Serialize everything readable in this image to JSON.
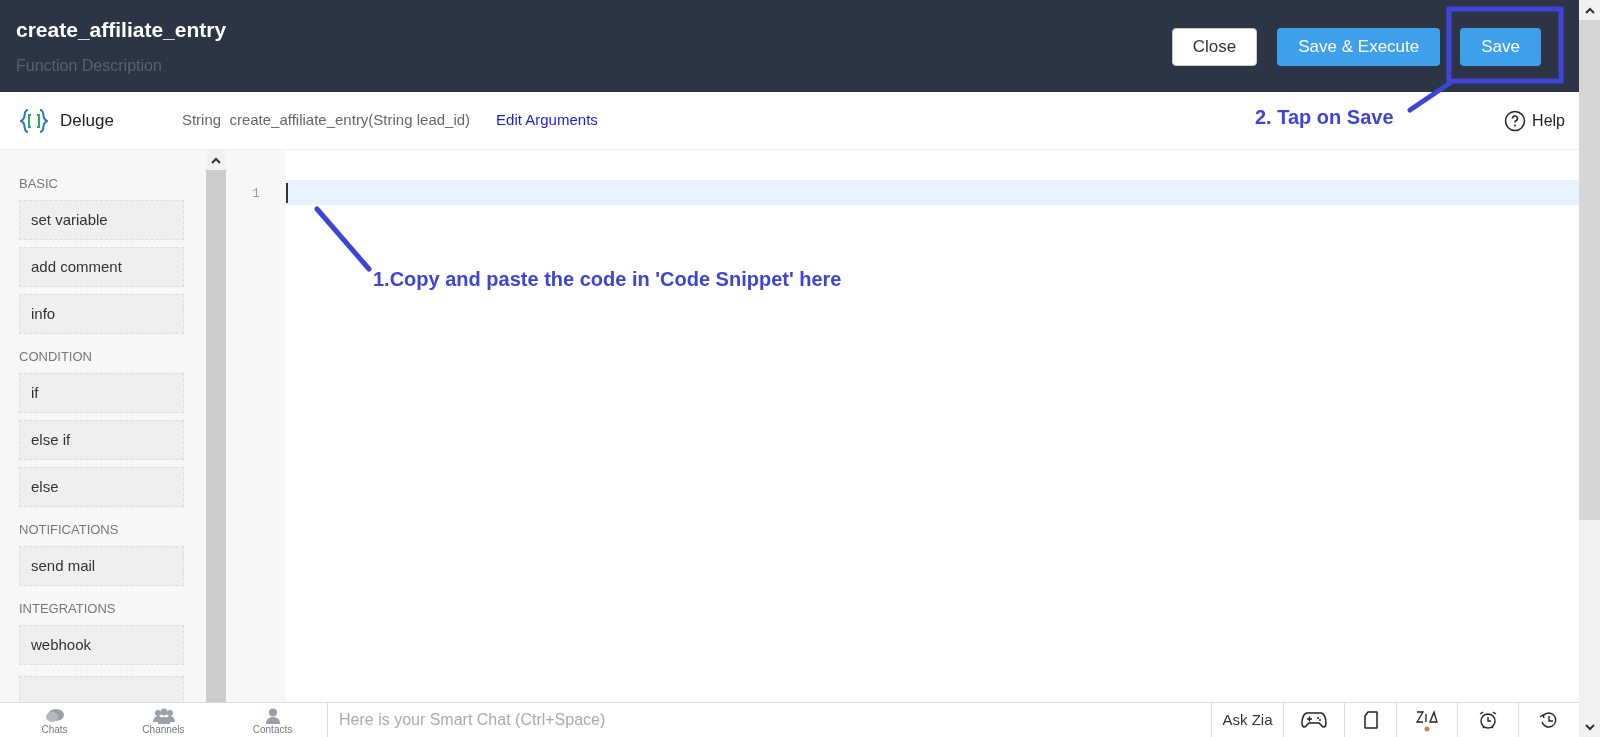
{
  "header": {
    "title": "create_affiliate_entry",
    "subtitle": "Function Description",
    "buttons": [
      {
        "label": "Close",
        "kind": "secondary"
      },
      {
        "label": "Save & Execute",
        "kind": "primary"
      },
      {
        "label": "Save",
        "kind": "primary"
      }
    ]
  },
  "toolbar": {
    "language": "Deluge",
    "signature": "String  create_affiliate_entry(String lead_id)",
    "link": "Edit Arguments",
    "help": "Help"
  },
  "sidebar": {
    "sections": [
      {
        "title": "BASIC",
        "items": [
          "set variable",
          "add comment",
          "info"
        ]
      },
      {
        "title": "CONDITION",
        "items": [
          "if",
          "else if",
          "else"
        ]
      },
      {
        "title": "NOTIFICATIONS",
        "items": [
          "send mail"
        ]
      },
      {
        "title": "INTEGRATIONS",
        "items": [
          "webhook"
        ]
      }
    ]
  },
  "editor": {
    "line_numbers": [
      "1"
    ]
  },
  "annotations": [
    {
      "text": "1.Copy and paste the code in 'Code Snippet' here"
    },
    {
      "text": "2. Tap on Save"
    }
  ],
  "bottom_bar": {
    "tabs": [
      {
        "label": "Chats",
        "kind": "chats"
      },
      {
        "label": "Channels",
        "kind": "channels"
      },
      {
        "label": "Contacts",
        "kind": "contacts"
      }
    ],
    "chat_placeholder": "Here is your Smart Chat (Ctrl+Space)",
    "ask": "Ask Zia"
  }
}
